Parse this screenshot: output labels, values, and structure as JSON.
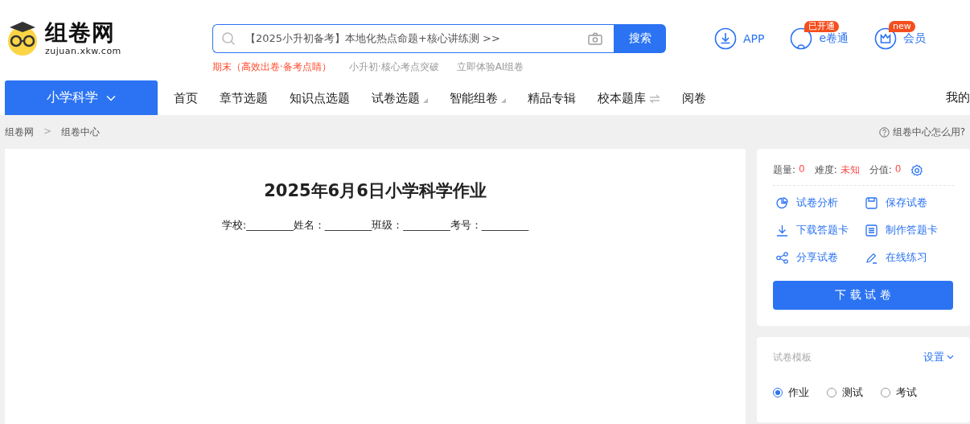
{
  "logo": {
    "title": "组卷网",
    "domain": "zujuan.xkw.com"
  },
  "search": {
    "value": "【2025小升初备考】本地化热点命题+核心讲练测 >>",
    "button": "搜索"
  },
  "hot_links": [
    {
      "label": "期末（高效出卷·备考点睛）",
      "kind": "highlight"
    },
    {
      "label": "小升初·核心考点突破",
      "kind": "plain"
    },
    {
      "label": "立即体验AI组卷",
      "kind": "plain"
    }
  ],
  "header_links": [
    {
      "kind": "app",
      "label": "APP"
    },
    {
      "kind": "ejuan",
      "label": "e卷通",
      "badge": "已开通"
    },
    {
      "kind": "member",
      "label": "会员",
      "badge": "new"
    }
  ],
  "subject": "小学科学",
  "nav": [
    {
      "kind": "plain",
      "label": "首页"
    },
    {
      "kind": "plain",
      "label": "章节选题"
    },
    {
      "kind": "plain",
      "label": "知识点选题"
    },
    {
      "kind": "dropdown",
      "label": "试卷选题"
    },
    {
      "kind": "dropdown",
      "label": "智能组卷"
    },
    {
      "kind": "plain",
      "label": "精品专辑"
    },
    {
      "kind": "switch",
      "label": "校本题库"
    },
    {
      "kind": "plain",
      "label": "阅卷"
    }
  ],
  "nav_right": "我的",
  "breadcrumb": [
    "组卷网",
    ">",
    "组卷中心"
  ],
  "help": "组卷中心怎么用?",
  "paper": {
    "title": "2025年6月6日小学科学作业",
    "info": "学校:_________姓名：_________班级：_________考号：_________"
  },
  "stats": [
    {
      "label": "题量:",
      "value": "0"
    },
    {
      "label": "难度:",
      "value": "未知"
    },
    {
      "label": "分值:",
      "value": "0"
    }
  ],
  "actions": [
    {
      "kind": "analysis",
      "label": "试卷分析"
    },
    {
      "kind": "save",
      "label": "保存试卷"
    },
    {
      "kind": "download",
      "label": "下载答题卡"
    },
    {
      "kind": "sheet",
      "label": "制作答题卡"
    },
    {
      "kind": "share",
      "label": "分享试卷"
    },
    {
      "kind": "practice",
      "label": "在线练习"
    }
  ],
  "download_button": "下 载 试 卷",
  "template": {
    "title": "试卷模板",
    "settings": "设置",
    "options": [
      {
        "label": "作业",
        "selected": true
      },
      {
        "label": "测试",
        "selected": false
      },
      {
        "label": "考试",
        "selected": false
      }
    ]
  }
}
